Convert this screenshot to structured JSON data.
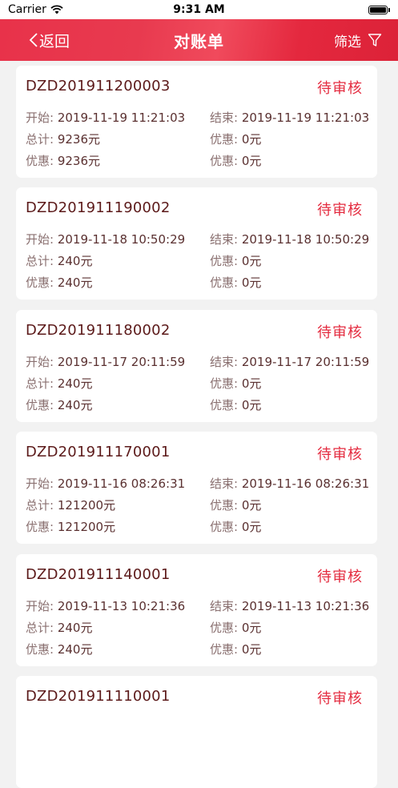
{
  "status_bar": {
    "carrier": "Carrier",
    "time": "9:31 AM"
  },
  "nav": {
    "back_label": "返回",
    "title": "对账单",
    "filter_label": "筛选"
  },
  "colors": {
    "accent": "#e42c40",
    "id_text": "#5c1a1a",
    "background": "#f2f2f2"
  },
  "labels": {
    "start": "开始:",
    "end": "结束:",
    "total": "总计:",
    "discount": "优惠:"
  },
  "statements": [
    {
      "id": "DZD201911200003",
      "status": "待审核",
      "start": "2019-11-19 11:21:03",
      "end": "2019-11-19 11:21:03",
      "total": "9236元",
      "discount_right": "0元",
      "discount_left": "9236元",
      "discount_right2": "0元"
    },
    {
      "id": "DZD201911190002",
      "status": "待审核",
      "start": "2019-11-18 10:50:29",
      "end": "2019-11-18 10:50:29",
      "total": "240元",
      "discount_right": "0元",
      "discount_left": "240元",
      "discount_right2": "0元"
    },
    {
      "id": "DZD201911180002",
      "status": "待审核",
      "start": "2019-11-17 20:11:59",
      "end": "2019-11-17 20:11:59",
      "total": "240元",
      "discount_right": "0元",
      "discount_left": "240元",
      "discount_right2": "0元"
    },
    {
      "id": "DZD201911170001",
      "status": "待审核",
      "start": "2019-11-16 08:26:31",
      "end": "2019-11-16 08:26:31",
      "total": "121200元",
      "discount_right": "0元",
      "discount_left": "121200元",
      "discount_right2": "0元"
    },
    {
      "id": "DZD201911140001",
      "status": "待审核",
      "start": "2019-11-13 10:21:36",
      "end": "2019-11-13 10:21:36",
      "total": "240元",
      "discount_right": "0元",
      "discount_left": "240元",
      "discount_right2": "0元"
    },
    {
      "id": "DZD201911110001",
      "status": "待审核"
    }
  ]
}
